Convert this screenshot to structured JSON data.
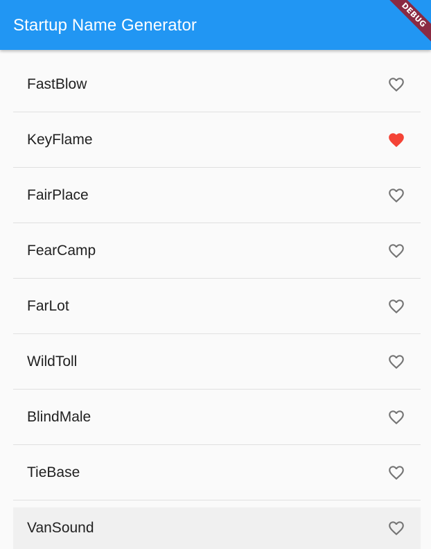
{
  "appbar": {
    "title": "Startup Name Generator",
    "color": "#2196f3"
  },
  "debug_banner": {
    "label": "DEBUG",
    "color": "#8a2a43"
  },
  "icons": {
    "favorite": "heart-filled-icon",
    "not_favorite": "heart-outline-icon",
    "favorite_color": "#f44336",
    "outline_color": "#757575"
  },
  "list": {
    "items": [
      {
        "label": "FastBlow",
        "saved": false
      },
      {
        "label": "KeyFlame",
        "saved": true
      },
      {
        "label": "FairPlace",
        "saved": false
      },
      {
        "label": "FearCamp",
        "saved": false
      },
      {
        "label": "FarLot",
        "saved": false
      },
      {
        "label": "WildToll",
        "saved": false
      },
      {
        "label": "BlindMale",
        "saved": false
      },
      {
        "label": "TieBase",
        "saved": false
      },
      {
        "label": "VanSound",
        "saved": false
      }
    ]
  }
}
